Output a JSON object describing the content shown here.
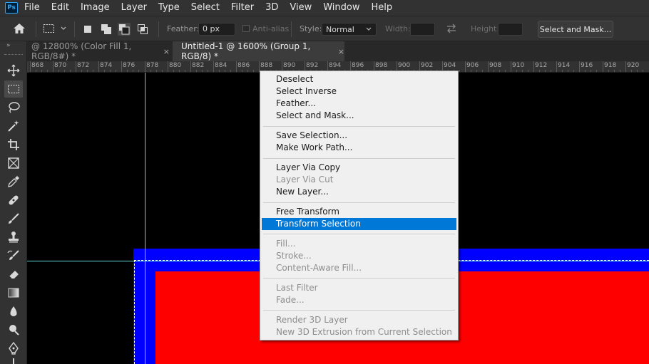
{
  "app": {
    "logo_text": "Ps",
    "menu": [
      "File",
      "Edit",
      "Image",
      "Layer",
      "Type",
      "Select",
      "Filter",
      "3D",
      "View",
      "Window",
      "Help"
    ]
  },
  "options_bar": {
    "feather_label": "Feather:",
    "feather_value": "0 px",
    "antialias_label": "Anti-alias",
    "style_label": "Style:",
    "style_value": "Normal",
    "width_label": "Width:",
    "height_label": "Height:",
    "select_mask_button": "Select and Mask..."
  },
  "tabs": [
    {
      "label": "@ 12800% (Color Fill 1, RGB/8#) *",
      "close": "×"
    },
    {
      "label": "Untitled-1 @ 1600% (Group 1, RGB/8) *",
      "close": "×"
    }
  ],
  "ruler": {
    "labels": [
      "868",
      "870",
      "872",
      "874",
      "876",
      "878",
      "880",
      "882",
      "884",
      "886",
      "888",
      "890",
      "892",
      "894",
      "896",
      "898",
      "900",
      "902",
      "904",
      "906",
      "908",
      "910",
      "912",
      "914",
      "916",
      "918",
      "920"
    ]
  },
  "context_menu": {
    "items": [
      {
        "label": "Deselect",
        "state": "normal"
      },
      {
        "label": "Select Inverse",
        "state": "normal"
      },
      {
        "label": "Feather...",
        "state": "normal"
      },
      {
        "label": "Select and Mask...",
        "state": "normal"
      },
      {
        "label": "Save Selection...",
        "state": "normal"
      },
      {
        "label": "Make Work Path...",
        "state": "normal"
      },
      {
        "label": "Layer Via Copy",
        "state": "normal"
      },
      {
        "label": "Layer Via Cut",
        "state": "disabled"
      },
      {
        "label": "New Layer...",
        "state": "normal"
      },
      {
        "label": "Free Transform",
        "state": "normal"
      },
      {
        "label": "Transform Selection",
        "state": "highlighted"
      },
      {
        "label": "Fill...",
        "state": "disabled"
      },
      {
        "label": "Stroke...",
        "state": "disabled"
      },
      {
        "label": "Content-Aware Fill...",
        "state": "disabled"
      },
      {
        "label": "Last Filter",
        "state": "disabled"
      },
      {
        "label": "Fade...",
        "state": "disabled"
      },
      {
        "label": "Render 3D Layer",
        "state": "disabled"
      },
      {
        "label": "New 3D Extrusion from Current Selection",
        "state": "disabled"
      }
    ]
  },
  "tools": [
    "move-tool",
    "rectangular-marquee-tool",
    "lasso-tool",
    "magic-wand-tool",
    "crop-tool",
    "frame-tool",
    "eyedropper-tool",
    "healing-brush-tool",
    "brush-tool",
    "clone-stamp-tool",
    "history-brush-tool",
    "eraser-tool",
    "gradient-tool",
    "blur-tool",
    "dodge-tool",
    "pen-tool"
  ],
  "colors": {
    "canvas_bg": "#000000",
    "blue_layer": "#0000ff",
    "red_layer": "#ff0000",
    "guide": "#5fd8d8",
    "menu_highlight": "#0078d7"
  }
}
